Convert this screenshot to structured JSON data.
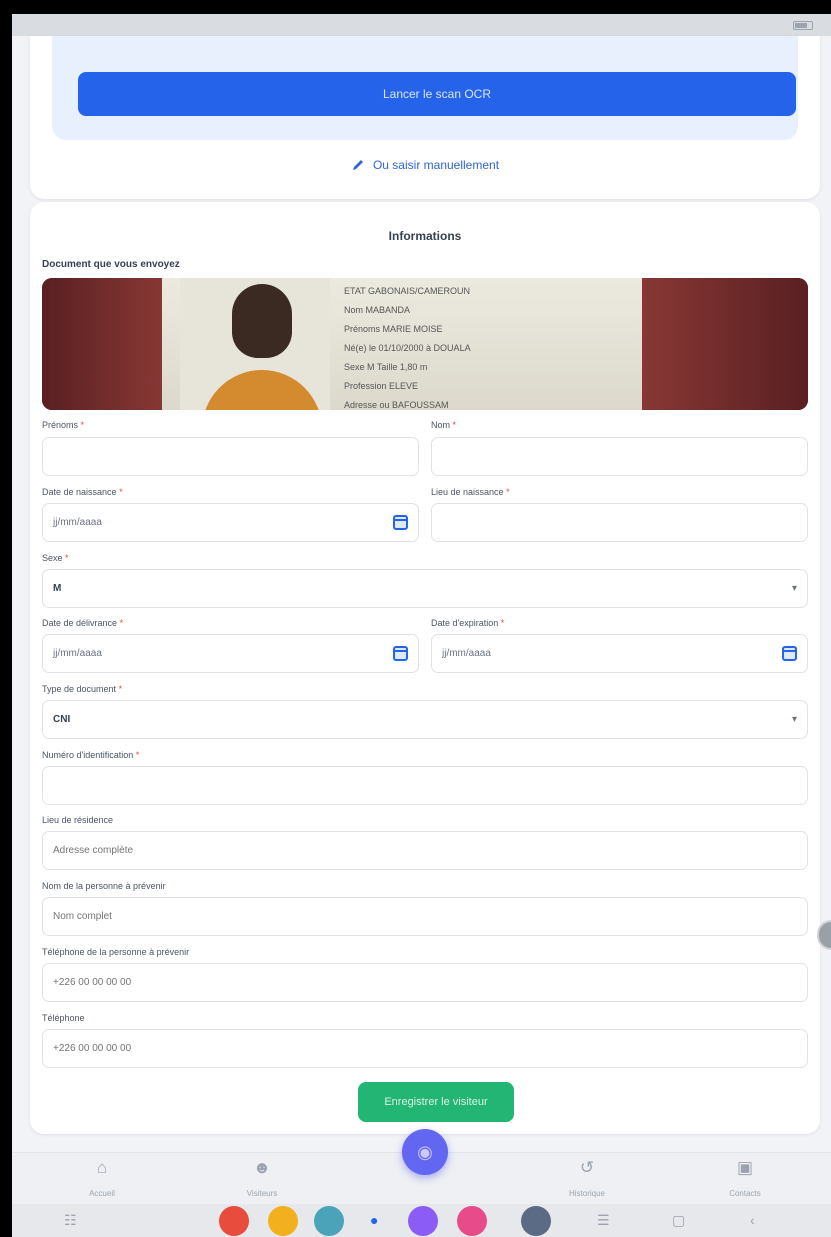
{
  "status_bar": {
    "time": "",
    "indicators": ""
  },
  "upload": {
    "hint": "",
    "scan_button": "Lancer le scan OCR",
    "manual_link": "Ou saisir manuellement",
    "manual_icon": "pencil-icon"
  },
  "form": {
    "title": "Informations",
    "document_label": "Document que vous envoyez",
    "document_image": {
      "lines": [
        "ETAT GABONAIS/CAMEROUN",
        "Nom  MABANDA",
        "Prénoms  MARIE MOISE",
        "Né(e) le  01/10/2000  à  DOUALA",
        "Sexe  M            Taille  1,80 m",
        "Profession  ELEVE",
        "Adresse ou   BAFOUSSAM"
      ]
    },
    "fields": {
      "prenoms": {
        "label": "Prénoms",
        "value": ""
      },
      "nom": {
        "label": "Nom",
        "value": ""
      },
      "date_naissance": {
        "label": "Date de naissance",
        "placeholder": "jj/mm/aaaa"
      },
      "lieu_naissance": {
        "label": "Lieu de naissance",
        "value": ""
      },
      "sexe": {
        "label": "Sexe",
        "value": "M"
      },
      "date_delivrance": {
        "label": "Date de délivrance",
        "placeholder": "jj/mm/aaaa"
      },
      "date_expiration": {
        "label": "Date d'expiration",
        "placeholder": "jj/mm/aaaa"
      },
      "type_document": {
        "label": "Type de document",
        "value": "CNI"
      },
      "numero_identification": {
        "label": "Numéro d'identification",
        "value": ""
      },
      "lieu_residence": {
        "label": "Lieu de résidence",
        "placeholder": "Adresse complète"
      },
      "nom_personne_prevenir": {
        "label": "Nom de la personne à prévenir",
        "placeholder": "Nom complet"
      },
      "tel_personne_prevenir": {
        "label": "Téléphone de la personne à prévenir",
        "placeholder": "+226 00 00 00 00"
      },
      "telephone": {
        "label": "Téléphone",
        "placeholder": "+226 00 00 00 00"
      }
    },
    "required_mark": "*",
    "save_button": "Enregistrer le visiteur"
  },
  "bottom_nav": {
    "items": [
      {
        "label": "Accueil",
        "icon": "home-icon"
      },
      {
        "label": "Visiteurs",
        "icon": "user-icon"
      },
      {
        "label": "Historique",
        "icon": "history-icon"
      },
      {
        "label": "Contacts",
        "icon": "briefcase-icon"
      }
    ],
    "fab_icon": "scan-icon"
  },
  "colors": {
    "primary": "#2563eb",
    "success": "#22b573",
    "fab": "#6366f1",
    "required": "#ef4444"
  }
}
